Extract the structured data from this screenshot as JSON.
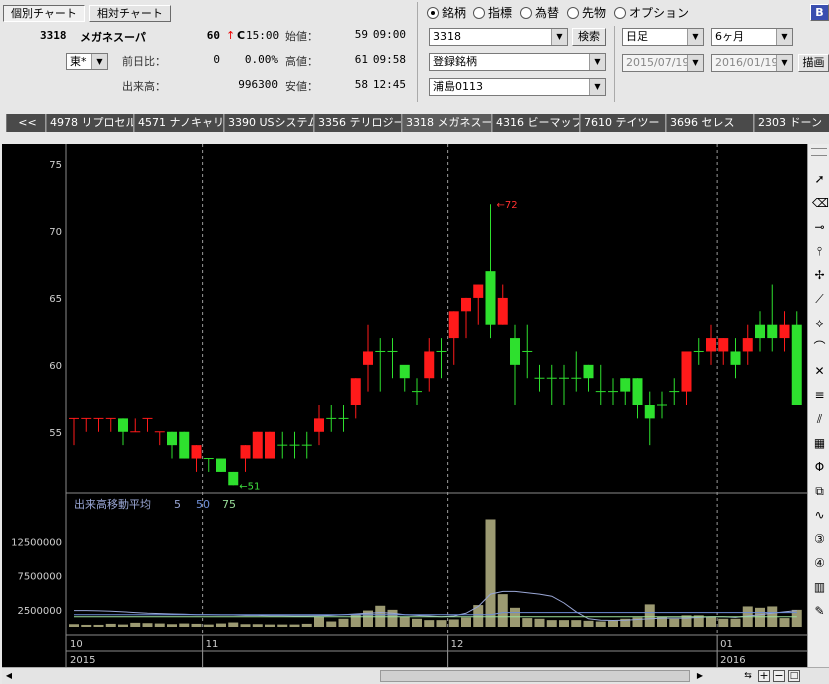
{
  "header": {
    "tab_single": "個別チャート",
    "tab_relative": "相対チャート",
    "stock_code": "3318",
    "stock_name": "メガネスーパ",
    "price": "60",
    "price_arrow": "↑",
    "price_mark": "C",
    "price_time": "15:00",
    "exchange": "東*",
    "prev_change_label": "前日比：",
    "prev_change": "0",
    "prev_change_pct": "0.00%",
    "volume_label": "出来高：",
    "volume": "996300",
    "open_label": "始値：",
    "open_value": "59",
    "open_time": "09:00",
    "high_label": "高値：",
    "high_value": "61",
    "high_time": "09:58",
    "low_label": "安値：",
    "low_value": "58",
    "low_time": "12:45"
  },
  "selector": {
    "radios": [
      {
        "label": "銘柄",
        "selected": true
      },
      {
        "label": "指標",
        "selected": false
      },
      {
        "label": "為替",
        "selected": false
      },
      {
        "label": "先物",
        "selected": false
      },
      {
        "label": "オプション",
        "selected": false
      }
    ],
    "code_value": "3318",
    "search_label": "検索",
    "category_value": "登録銘柄",
    "list_value": "浦島0113",
    "period_value": "日足",
    "range_value": "6ヶ月",
    "date_from": "2015/07/19",
    "date_to": "2016/01/19",
    "draw_label": "描画",
    "corner_label": "B"
  },
  "tabs": [
    {
      "label": "<<",
      "active": false
    },
    {
      "label": "4978 リプロセル",
      "active": false
    },
    {
      "label": "4571 ナノキャリア",
      "active": false
    },
    {
      "label": "3390 USシステム",
      "active": false
    },
    {
      "label": "3356 テリロジー",
      "active": false
    },
    {
      "label": "3318 メガネスーパ",
      "active": true
    },
    {
      "label": "4316 ビーマップ",
      "active": false
    },
    {
      "label": "7610 テイツー",
      "active": false
    },
    {
      "label": "3696 セレス",
      "active": false
    },
    {
      "label": "2303 ドーン",
      "active": false
    }
  ],
  "chart_data": [
    {
      "type": "candlestick",
      "price_axis": {
        "ticks": [
          55,
          60,
          65,
          70,
          75
        ],
        "range": [
          50.5,
          76.5
        ]
      },
      "annotations": [
        {
          "text": "←51",
          "candle_index": 13,
          "price": 51
        },
        {
          "text": "←72",
          "candle_index": 34,
          "price": 72
        }
      ],
      "candles": [
        {
          "o": 56,
          "h": 56,
          "l": 54,
          "c": 56
        },
        {
          "o": 56,
          "h": 56,
          "l": 55,
          "c": 56
        },
        {
          "o": 56,
          "h": 56,
          "l": 55,
          "c": 56
        },
        {
          "o": 56,
          "h": 56,
          "l": 55,
          "c": 56
        },
        {
          "o": 56,
          "h": 56,
          "l": 54,
          "c": 55
        },
        {
          "o": 55,
          "h": 56,
          "l": 55,
          "c": 55
        },
        {
          "o": 56,
          "h": 56,
          "l": 55,
          "c": 56
        },
        {
          "o": 55,
          "h": 55,
          "l": 54,
          "c": 55
        },
        {
          "o": 55,
          "h": 55,
          "l": 53,
          "c": 54
        },
        {
          "o": 55,
          "h": 55,
          "l": 53,
          "c": 53
        },
        {
          "o": 53,
          "h": 54,
          "l": 52,
          "c": 54
        },
        {
          "o": 53,
          "h": 53,
          "l": 52,
          "c": 53
        },
        {
          "o": 53,
          "h": 53,
          "l": 52,
          "c": 52
        },
        {
          "o": 52,
          "h": 52,
          "l": 51,
          "c": 51
        },
        {
          "o": 53,
          "h": 54,
          "l": 52,
          "c": 54
        },
        {
          "o": 53,
          "h": 55,
          "l": 53,
          "c": 55
        },
        {
          "o": 53,
          "h": 55,
          "l": 53,
          "c": 55
        },
        {
          "o": 54,
          "h": 55,
          "l": 53,
          "c": 54
        },
        {
          "o": 54,
          "h": 55,
          "l": 53,
          "c": 54
        },
        {
          "o": 54,
          "h": 55,
          "l": 53,
          "c": 54
        },
        {
          "o": 55,
          "h": 57,
          "l": 54,
          "c": 56
        },
        {
          "o": 56,
          "h": 57,
          "l": 55,
          "c": 56
        },
        {
          "o": 56,
          "h": 57,
          "l": 55,
          "c": 56
        },
        {
          "o": 57,
          "h": 59,
          "l": 56,
          "c": 59
        },
        {
          "o": 60,
          "h": 63,
          "l": 58,
          "c": 61
        },
        {
          "o": 61,
          "h": 62,
          "l": 58,
          "c": 61
        },
        {
          "o": 61,
          "h": 62,
          "l": 59,
          "c": 61
        },
        {
          "o": 60,
          "h": 59,
          "l": 58,
          "c": 59
        },
        {
          "o": 58,
          "h": 59,
          "l": 57,
          "c": 58
        },
        {
          "o": 59,
          "h": 62,
          "l": 58,
          "c": 61
        },
        {
          "o": 61,
          "h": 62,
          "l": 59,
          "c": 61
        },
        {
          "o": 62,
          "h": 64,
          "l": 60,
          "c": 64
        },
        {
          "o": 64,
          "h": 65,
          "l": 62,
          "c": 65
        },
        {
          "o": 65,
          "h": 66,
          "l": 63,
          "c": 66
        },
        {
          "o": 67,
          "h": 72,
          "l": 62,
          "c": 63
        },
        {
          "o": 63,
          "h": 66,
          "l": 63,
          "c": 65
        },
        {
          "o": 62,
          "h": 63,
          "l": 57,
          "c": 60
        },
        {
          "o": 61,
          "h": 63,
          "l": 59,
          "c": 61
        },
        {
          "o": 59,
          "h": 60,
          "l": 58,
          "c": 59
        },
        {
          "o": 59,
          "h": 60,
          "l": 57,
          "c": 59
        },
        {
          "o": 59,
          "h": 60,
          "l": 57,
          "c": 59
        },
        {
          "o": 59,
          "h": 61,
          "l": 58,
          "c": 59
        },
        {
          "o": 60,
          "h": 60,
          "l": 58,
          "c": 59
        },
        {
          "o": 58,
          "h": 60,
          "l": 57,
          "c": 58
        },
        {
          "o": 58,
          "h": 59,
          "l": 57,
          "c": 58
        },
        {
          "o": 59,
          "h": 59,
          "l": 57,
          "c": 58
        },
        {
          "o": 59,
          "h": 59,
          "l": 56,
          "c": 57
        },
        {
          "o": 57,
          "h": 58,
          "l": 54,
          "c": 56
        },
        {
          "o": 57,
          "h": 58,
          "l": 56,
          "c": 57
        },
        {
          "o": 58,
          "h": 59,
          "l": 57,
          "c": 58
        },
        {
          "o": 58,
          "h": 61,
          "l": 57,
          "c": 61
        },
        {
          "o": 61,
          "h": 62,
          "l": 60,
          "c": 61
        },
        {
          "o": 61,
          "h": 63,
          "l": 60,
          "c": 62
        },
        {
          "o": 61,
          "h": 62,
          "l": 60,
          "c": 62
        },
        {
          "o": 61,
          "h": 62,
          "l": 59,
          "c": 60
        },
        {
          "o": 61,
          "h": 63,
          "l": 60,
          "c": 62
        },
        {
          "o": 63,
          "h": 64,
          "l": 61,
          "c": 62
        },
        {
          "o": 63,
          "h": 66,
          "l": 61,
          "c": 62
        },
        {
          "o": 62,
          "h": 64,
          "l": 61,
          "c": 63
        },
        {
          "o": 63,
          "h": 64,
          "l": 57,
          "c": 57
        }
      ]
    },
    {
      "type": "bar",
      "title": "出来高移動平均",
      "ma_periods": [
        5,
        50,
        75
      ],
      "ma_colors": [
        "#9aa7d6",
        "#6f8fd8",
        "#9adf9a"
      ],
      "y_ticks": [
        2500000,
        7500000,
        12500000
      ],
      "ylim": [
        0,
        16500000
      ],
      "values": [
        400000,
        300000,
        300000,
        450000,
        350000,
        600000,
        550000,
        500000,
        400000,
        500000,
        450000,
        350000,
        500000,
        650000,
        400000,
        400000,
        350000,
        350000,
        350000,
        450000,
        1500000,
        800000,
        1200000,
        1900000,
        2400000,
        3100000,
        2500000,
        1500000,
        1200000,
        1000000,
        1000000,
        1100000,
        1400000,
        3200000,
        15700000,
        4800000,
        2800000,
        1300000,
        1200000,
        1000000,
        1000000,
        1000000,
        900000,
        800000,
        900000,
        1200000,
        1400000,
        3300000,
        1500000,
        1200000,
        1700000,
        1700000,
        1500000,
        1200000,
        1200000,
        3000000,
        2800000,
        3000000,
        1300000,
        2500000
      ],
      "ma5": [
        2400000,
        2400000,
        2350000,
        2300000,
        2200000,
        2100000,
        2000000,
        1950000,
        1900000,
        1850000,
        1800000,
        1800000,
        1750000,
        1750000,
        1700000,
        1700000,
        1650000,
        1650000,
        1600000,
        1600000,
        1650000,
        1700000,
        1800000,
        1900000,
        2000000,
        2100000,
        2000000,
        1800000,
        1700000,
        1600000,
        1500000,
        1600000,
        2000000,
        3000000,
        4800000,
        5200000,
        5200000,
        5000000,
        4800000,
        4500000,
        3500000,
        2200000,
        1200000,
        1000000,
        950000,
        1000000,
        1100000,
        1200000,
        1300000,
        1300000,
        1300000,
        1400000,
        1500000,
        1500000,
        1400000,
        1600000,
        1800000,
        2000000,
        2200000,
        2400000
      ]
    }
  ],
  "axis": {
    "month_labels": [
      "10",
      "11",
      "12",
      "01"
    ],
    "year_labels": [
      "2015",
      "2016"
    ],
    "volume_labels": [
      "12500000",
      "7500000",
      "2500000"
    ],
    "legend_title": "出来高移動平均",
    "legend_periods": [
      "5",
      "50",
      "75"
    ]
  },
  "toolbar_icons": [
    "cursor-icon",
    "eraser-icon",
    "line-tool-icon",
    "vertical-line-icon",
    "cross-line-icon",
    "trend-line-icon",
    "fan-line-icon",
    "arc-icon",
    "fan-angle-icon",
    "speed-line-icon",
    "parallel-line-icon",
    "grid-line-icon",
    "fibonacci-icon",
    "channel-icon",
    "wave-icon",
    "numbering-icon",
    "count-icon",
    "bars-icon",
    "pen-icon"
  ]
}
